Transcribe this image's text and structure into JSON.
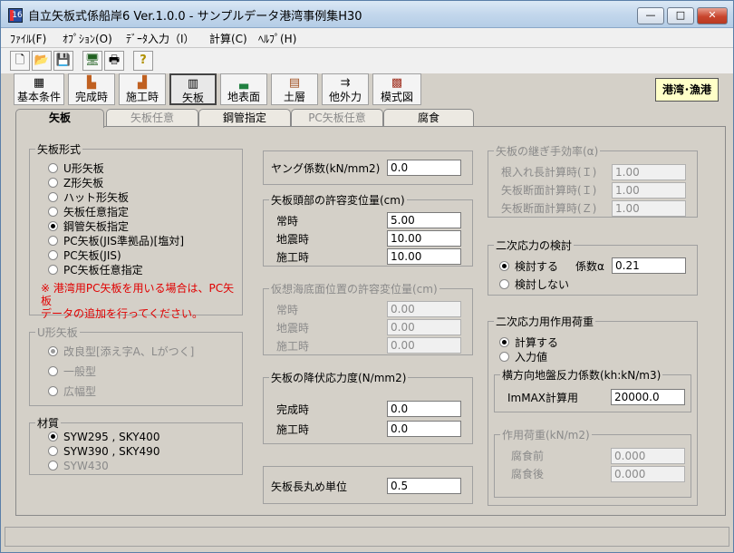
{
  "window": {
    "title": "自立矢板式係船岸6 Ver.1.0.0 - サンプルデータ港湾事例集H30",
    "app_icon_text": "16",
    "controls": {
      "minimize": "—",
      "maximize": "□",
      "close": "✕"
    }
  },
  "menu": [
    "ﾌｧｲﾙ(F)",
    "ｵﾌﾟｼｮﾝ(O)",
    "ﾃﾞｰﾀ入力（I）",
    "計算(C)",
    "ﾍﾙﾌﾟ(H)"
  ],
  "toolbar_small": [
    {
      "icon": "new-doc-icon",
      "glyph": "🗋"
    },
    {
      "icon": "open-folder-icon",
      "glyph": "📂"
    },
    {
      "icon": "save-icon",
      "glyph": "💾"
    },
    {
      "icon": "monitor-icon",
      "glyph": "🖥"
    },
    {
      "icon": "printer-icon",
      "glyph": "🖶"
    },
    {
      "icon": "help-icon",
      "glyph": "?"
    }
  ],
  "toolbar_big": [
    {
      "label": "基本条件",
      "icon": "grid-icon",
      "glyph": "▦"
    },
    {
      "label": "完成時",
      "icon": "structure-icon",
      "glyph": "▙"
    },
    {
      "label": "施工時",
      "icon": "construction-icon",
      "glyph": "▟"
    },
    {
      "label": "矢板",
      "icon": "sheet-pile-icon",
      "glyph": "▥"
    },
    {
      "label": "地表面",
      "icon": "ground-surface-icon",
      "glyph": "▃"
    },
    {
      "label": "土層",
      "icon": "soil-layer-icon",
      "glyph": "▤"
    },
    {
      "label": "他外力",
      "icon": "external-force-icon",
      "glyph": "⇉"
    },
    {
      "label": "模式図",
      "icon": "diagram-icon",
      "glyph": "▩"
    }
  ],
  "badge": "港湾･漁港",
  "tabs": [
    {
      "label": "矢板",
      "state": "active"
    },
    {
      "label": "矢板任意",
      "state": "disabled"
    },
    {
      "label": "鋼管指定",
      "state": "normal"
    },
    {
      "label": "PC矢板任意",
      "state": "disabled"
    },
    {
      "label": "腐食",
      "state": "normal"
    }
  ],
  "sheet_type": {
    "title": "矢板形式",
    "options": [
      "U形矢板",
      "Z形矢板",
      "ハット形矢板",
      "矢板任意指定",
      "鋼管矢板指定",
      "PC矢板(JIS準拠品)[塩対]",
      "PC矢板(JIS)",
      "PC矢板任意指定"
    ],
    "selected_index": 4,
    "note_line1": "※ 港湾用PC矢板を用いる場合は、PC矢板",
    "note_line2": "データの追加を行ってください。"
  },
  "u_sheet": {
    "title": "U形矢板",
    "options": [
      "改良型[添え字A、Lがつく]",
      "一般型",
      "広幅型"
    ],
    "selected_index": 0
  },
  "material": {
    "title": "材質",
    "options": [
      "SYW295 , SKY400",
      "SYW390 , SKY490",
      "SYW430"
    ],
    "selected_index": 0
  },
  "young": {
    "label": "ヤング係数(kN/mm2)",
    "value": "0.0"
  },
  "head_disp": {
    "title": "矢板頭部の許容変位量(cm)",
    "rows": [
      {
        "label": "常時",
        "value": "5.00"
      },
      {
        "label": "地震時",
        "value": "10.00"
      },
      {
        "label": "施工時",
        "value": "10.00"
      }
    ]
  },
  "virtual_disp": {
    "title": "仮想海底面位置の許容変位量(cm)",
    "rows": [
      {
        "label": "常時",
        "value": "0.00"
      },
      {
        "label": "地震時",
        "value": "0.00"
      },
      {
        "label": "施工時",
        "value": "0.00"
      }
    ]
  },
  "yield": {
    "title": "矢板の降伏応力度(N/mm2)",
    "rows": [
      {
        "label": "完成時",
        "value": "0.0"
      },
      {
        "label": "施工時",
        "value": "0.0"
      }
    ]
  },
  "rounding": {
    "label": "矢板長丸め単位",
    "value": "0.5"
  },
  "joint_eff": {
    "title": "矢板の継ぎ手効率(α)",
    "rows": [
      {
        "label": "根入れ長計算時(Ｉ)",
        "value": "1.00"
      },
      {
        "label": "矢板断面計算時(Ｉ)",
        "value": "1.00"
      },
      {
        "label": "矢板断面計算時(Ｚ)",
        "value": "1.00"
      }
    ]
  },
  "secondary_check": {
    "title": "二次応力の検討",
    "options": [
      "検討する",
      "検討しない"
    ],
    "selected_index": 0,
    "coef_label": "係数α",
    "coef_value": "0.21"
  },
  "secondary_load": {
    "title": "二次応力用作用荷重",
    "options": [
      "計算する",
      "入力値"
    ],
    "selected_index": 0,
    "subgrade": {
      "title": "横方向地盤反力係数(kh:kN/m3)",
      "label": "ImMAX計算用",
      "value": "20000.0"
    },
    "acting": {
      "title": "作用荷重(kN/m2)",
      "rows": [
        {
          "label": "腐食前",
          "value": "0.000"
        },
        {
          "label": "腐食後",
          "value": "0.000"
        }
      ]
    }
  }
}
